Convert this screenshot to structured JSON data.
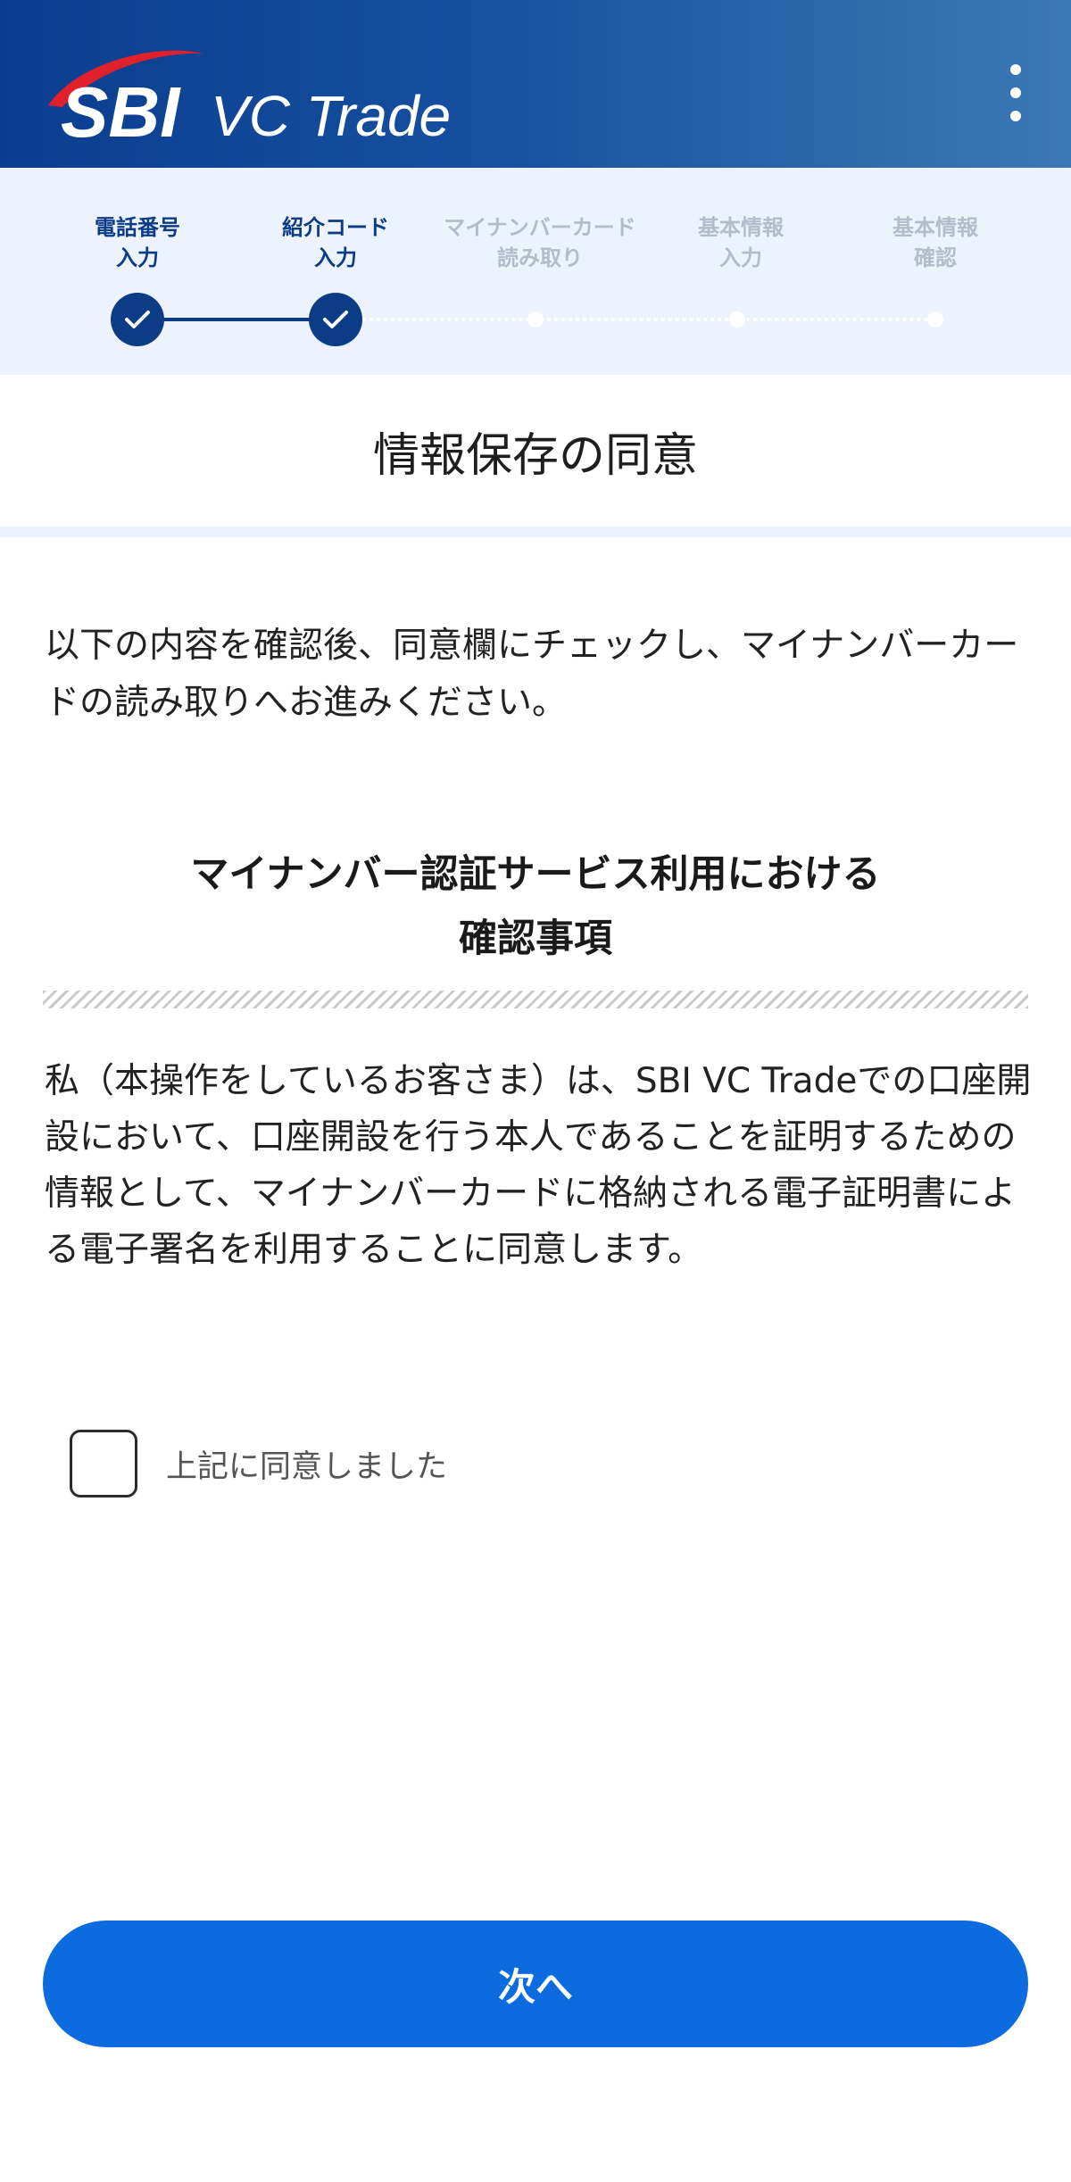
{
  "header": {
    "logo_text_primary": "SBI",
    "logo_text_secondary": "VC Trade",
    "menu_icon": "more-vertical-icon",
    "colors": {
      "header_start": "#0a3d8f",
      "header_end": "#3c78b4",
      "logo_swoosh": "#e0202a"
    }
  },
  "stepper": {
    "steps": [
      {
        "label": "電話番号\n入力",
        "status": "done"
      },
      {
        "label": "紹介コード\n入力",
        "status": "done"
      },
      {
        "label": "マイナンバーカード\n読み取り",
        "status": "pending"
      },
      {
        "label": "基本情報\n入力",
        "status": "pending"
      },
      {
        "label": "基本情報\n確認",
        "status": "pending"
      }
    ],
    "done_icon": "check-icon"
  },
  "page": {
    "title": "情報保存の同意",
    "intro": "以下の内容を確認後、同意欄にチェックし、マイナンバーカードの読み取りへお進みください。",
    "section_heading_line1": "マイナンバー認証サービス利用における",
    "section_heading_line2": "確認事項",
    "consent_body": "私（本操作をしているお客さま）は、SBI VC Tradeでの口座開設において、口座開設を行う本人であることを証明するための情報として、マイナンバーカードに格納される電子証明書による電子署名を利用することに同意します。",
    "agree_label": "上記に同意しました",
    "agree_checked": false,
    "next_label": "次へ"
  },
  "colors": {
    "primary_button": "#0d6be0",
    "step_done": "#0c3c86",
    "step_pending": "#b3bccb",
    "stepper_bg": "#edf3fd"
  }
}
